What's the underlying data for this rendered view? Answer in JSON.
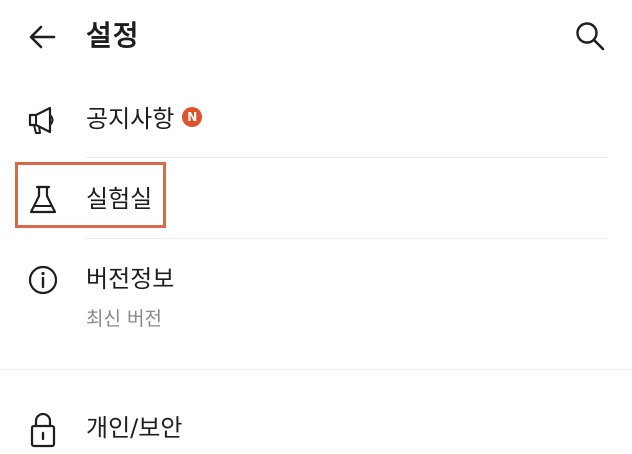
{
  "header": {
    "title": "설정"
  },
  "rows": {
    "notice": {
      "label": "공지사항",
      "badge": "N"
    },
    "lab": {
      "label": "실험실"
    },
    "version": {
      "label": "버전정보",
      "sub": "최신 버전"
    },
    "privacy": {
      "label": "개인/보안"
    }
  },
  "colors": {
    "accent": "#e0522c",
    "highlight": "#d9694c",
    "divider": "#ececec",
    "subtext": "#8a8a8a"
  }
}
